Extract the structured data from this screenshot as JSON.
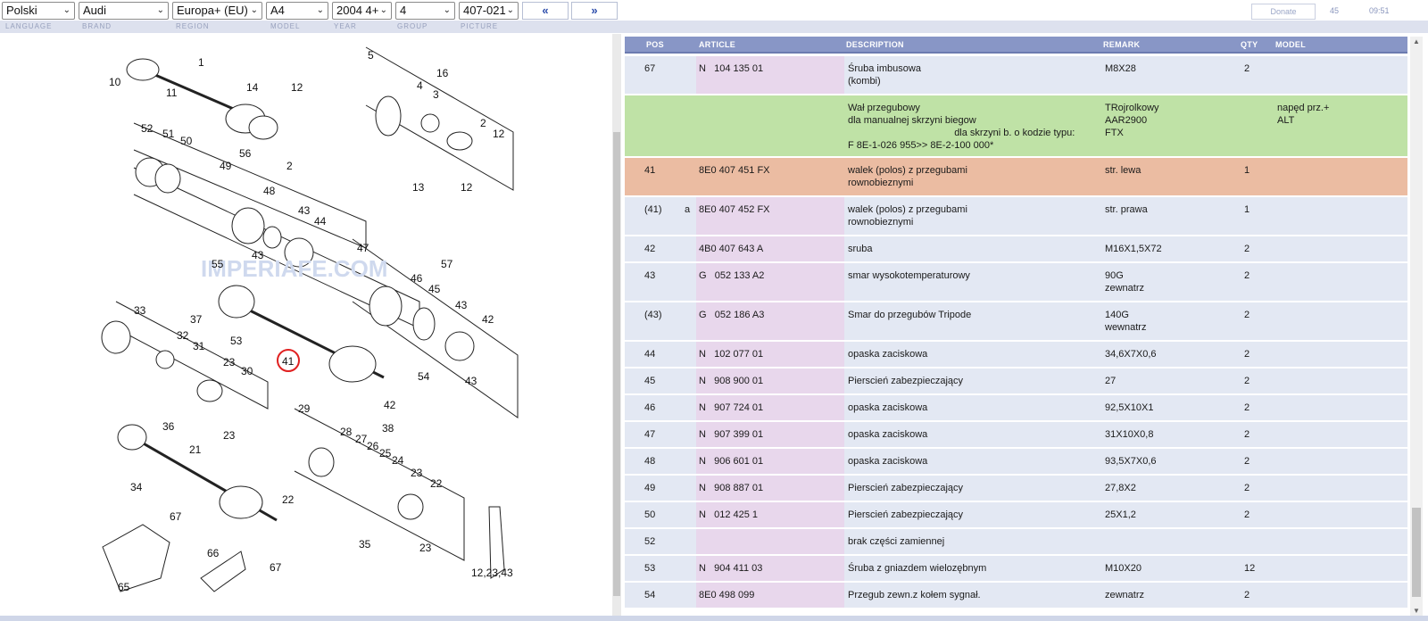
{
  "toolbar": {
    "language": "Polski",
    "brand": "Audi",
    "region": "Europa+ (EU)",
    "model": "A4",
    "year": "2004  4+",
    "group": "4",
    "picture": "407-021",
    "prev_label": "«",
    "next_label": "»",
    "donate_label": "Donate",
    "counter": "45",
    "clock": "09:51"
  },
  "labels": {
    "language": "LANGUAGE",
    "brand": "BRAND",
    "region": "REGION",
    "model": "MODEL",
    "year": "YEAR",
    "group": "GROUP",
    "picture": "PICTURE"
  },
  "diagram": {
    "watermark": "IMPERIAFE.COM",
    "highlighted_callout": "41",
    "callouts": [
      "1",
      "10",
      "11",
      "14",
      "12",
      "2",
      "5",
      "16",
      "4",
      "3",
      "2",
      "12",
      "13",
      "12",
      "52",
      "51",
      "50",
      "49",
      "56",
      "48",
      "43",
      "44",
      "55",
      "43",
      "47",
      "57",
      "46",
      "45",
      "43",
      "42",
      "41",
      "54",
      "42",
      "43",
      "53",
      "33",
      "37",
      "32",
      "31",
      "23",
      "30",
      "36",
      "23",
      "29",
      "28",
      "27",
      "26",
      "25",
      "24",
      "38",
      "23",
      "22",
      "21",
      "34",
      "67",
      "22",
      "35",
      "23",
      "66",
      "67",
      "65",
      "12,23,43"
    ]
  },
  "table": {
    "headers": {
      "pos": "POS",
      "article": "ARTICLE",
      "description": "DESCRIPTION",
      "remark": "REMARK",
      "qty": "QTY",
      "model": "MODEL"
    },
    "rows": [
      {
        "pos": "67",
        "sub": "",
        "article": "N   104 135 01",
        "description": "Śruba imbusowa\n(kombi)",
        "remark": "M8X28",
        "qty": "2",
        "model": ""
      },
      {
        "pos": "",
        "sub": "",
        "article": "",
        "description": "Wał przegubowy\ndla manualnej skrzyni biegow\n                                       dla skrzyni b. o kodzie typu:\nF 8E-1-026 955>> 8E-2-100 000*",
        "remark": "TRojrolkowy\nAAR2900\nFTX",
        "qty": "",
        "model": "napęd prz.+\nALT"
      },
      {
        "pos": "41",
        "sub": "",
        "article": "8E0 407 451 FX",
        "description": "walek (polos) z przegubami\nrownobieznymi",
        "remark": "str. lewa",
        "qty": "1",
        "model": ""
      },
      {
        "pos": "(41)",
        "sub": "a",
        "article": "8E0 407 452 FX",
        "description": "walek (polos) z przegubami\nrownobieznymi",
        "remark": "str. prawa",
        "qty": "1",
        "model": ""
      },
      {
        "pos": "42",
        "sub": "",
        "article": "4B0 407 643 A",
        "description": "sruba",
        "remark": "M16X1,5X72",
        "qty": "2",
        "model": ""
      },
      {
        "pos": "43",
        "sub": "",
        "article": "G   052 133 A2",
        "description": "smar wysokotemperaturowy",
        "remark": "90G\nzewnatrz",
        "qty": "2",
        "model": ""
      },
      {
        "pos": "(43)",
        "sub": "",
        "article": "G   052 186 A3",
        "description": "Smar do przegubów Tripode",
        "remark": "140G\nwewnatrz",
        "qty": "2",
        "model": ""
      },
      {
        "pos": "44",
        "sub": "",
        "article": "N   102 077 01",
        "description": "opaska zaciskowa",
        "remark": "34,6X7X0,6",
        "qty": "2",
        "model": ""
      },
      {
        "pos": "45",
        "sub": "",
        "article": "N   908 900 01",
        "description": "Pierscień zabezpieczający",
        "remark": "27",
        "qty": "2",
        "model": ""
      },
      {
        "pos": "46",
        "sub": "",
        "article": "N   907 724 01",
        "description": "opaska zaciskowa",
        "remark": "92,5X10X1",
        "qty": "2",
        "model": ""
      },
      {
        "pos": "47",
        "sub": "",
        "article": "N   907 399 01",
        "description": "opaska zaciskowa",
        "remark": "31X10X0,8",
        "qty": "2",
        "model": ""
      },
      {
        "pos": "48",
        "sub": "",
        "article": "N   906 601 01",
        "description": "opaska zaciskowa",
        "remark": "93,5X7X0,6",
        "qty": "2",
        "model": ""
      },
      {
        "pos": "49",
        "sub": "",
        "article": "N   908 887 01",
        "description": "Pierscień zabezpieczający",
        "remark": "27,8X2",
        "qty": "2",
        "model": ""
      },
      {
        "pos": "50",
        "sub": "",
        "article": "N   012 425 1",
        "description": "Pierscień zabezpieczający",
        "remark": "25X1,2",
        "qty": "2",
        "model": ""
      },
      {
        "pos": "52",
        "sub": "",
        "article": "",
        "description": "brak części zamiennej",
        "remark": "",
        "qty": "",
        "model": ""
      },
      {
        "pos": "53",
        "sub": "",
        "article": "N   904 411 03",
        "description": "Śruba z gniazdem wielozębnym",
        "remark": "M10X20",
        "qty": "12",
        "model": ""
      },
      {
        "pos": "54",
        "sub": "",
        "article": "8E0 498 099",
        "description": "Przegub zewn.z kołem sygnał.",
        "remark": "zewnatrz",
        "qty": "2",
        "model": ""
      }
    ]
  },
  "colors": {
    "header_bg": "#8896c6",
    "row_bg": "#e3e8f3",
    "article_bg": "#e8d7ec",
    "group_row_bg": "#bfe2a6",
    "selected_row_bg": "#ebbca2",
    "callout_highlight": "#e02020"
  }
}
